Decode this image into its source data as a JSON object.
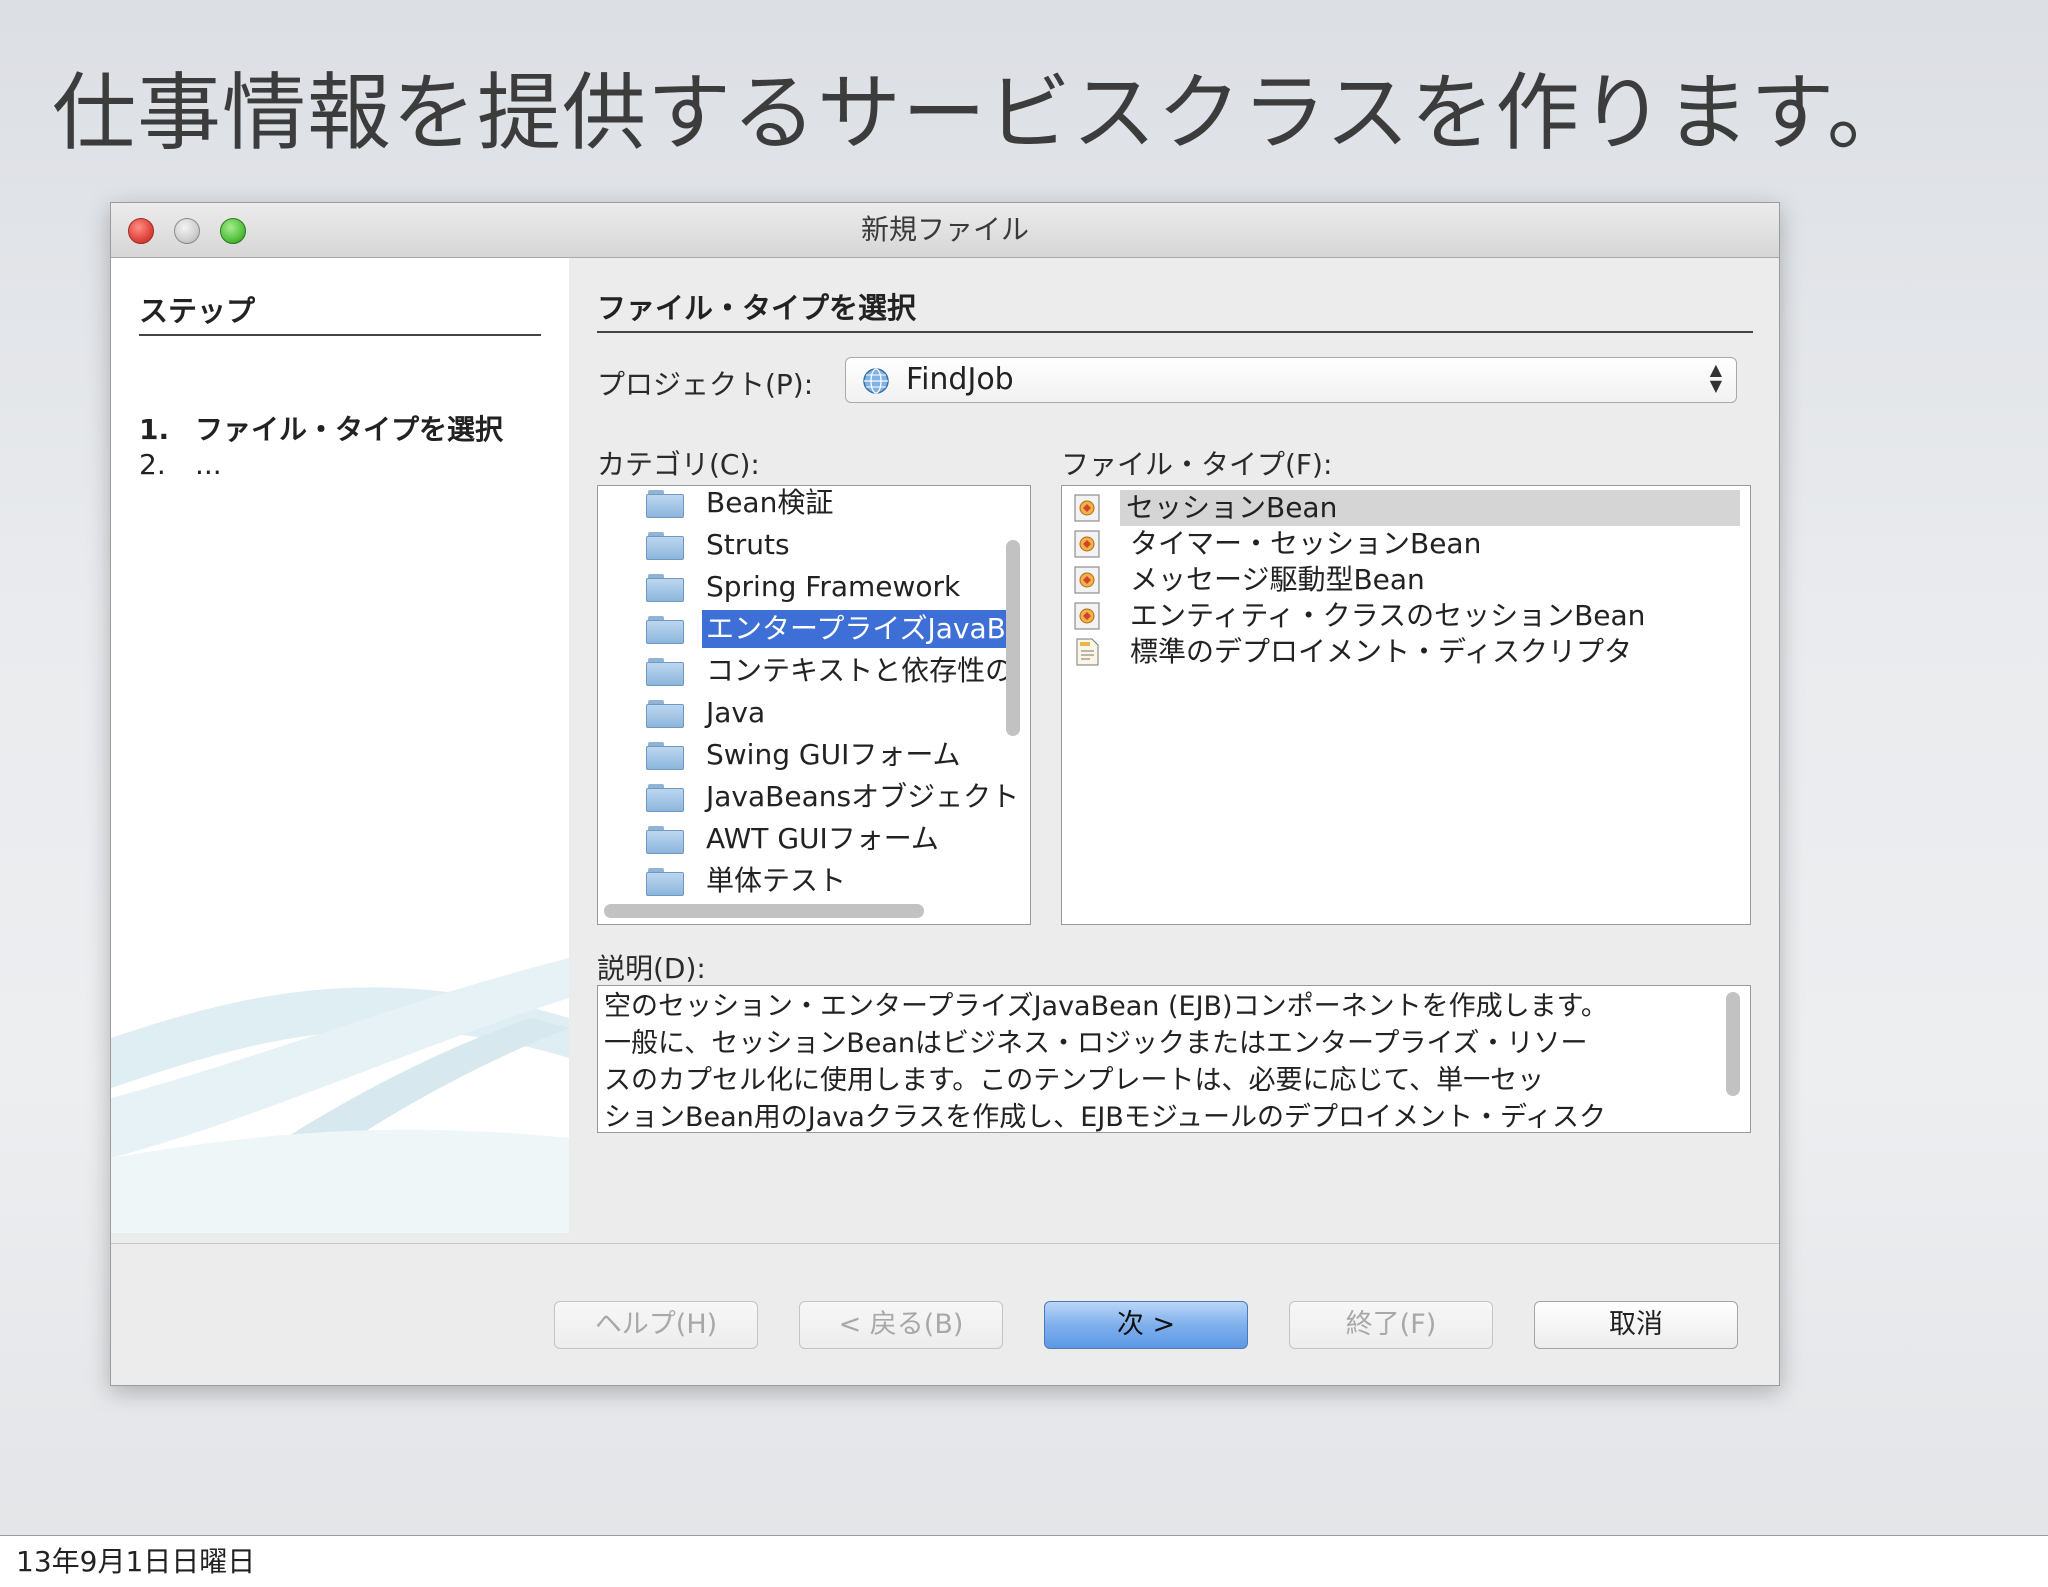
{
  "slide": {
    "title": "仕事情報を提供するサービスクラスを作ります。",
    "footer_date": "13年9月1日日曜日"
  },
  "dialog": {
    "title": "新規ファイル",
    "steps": {
      "heading": "ステップ",
      "items": [
        {
          "num": "1.",
          "label": "ファイル・タイプを選択"
        },
        {
          "num": "2.",
          "label": "..."
        }
      ]
    },
    "main_heading": "ファイル・タイプを選択",
    "project": {
      "label": "プロジェクト(P):",
      "value": "FindJob",
      "icon": "globe-icon"
    },
    "categories": {
      "label": "カテゴリ(C):",
      "items": [
        {
          "label": "Bean検証",
          "icon": "folder-icon"
        },
        {
          "label": "Struts",
          "icon": "folder-icon"
        },
        {
          "label": "Spring Framework",
          "icon": "folder-icon"
        },
        {
          "label": "エンタープライズJavaB",
          "icon": "folder-icon",
          "selected": true
        },
        {
          "label": "コンテキストと依存性の",
          "icon": "folder-icon"
        },
        {
          "label": "Java",
          "icon": "folder-icon"
        },
        {
          "label": "Swing GUIフォーム",
          "icon": "folder-icon"
        },
        {
          "label": "JavaBeansオブジェクト",
          "icon": "folder-icon"
        },
        {
          "label": "AWT GUIフォーム",
          "icon": "folder-icon"
        },
        {
          "label": "単体テスト",
          "icon": "folder-icon"
        }
      ]
    },
    "file_types": {
      "label": "ファイル・タイプ(F):",
      "items": [
        {
          "label": "セッションBean",
          "icon": "bean-icon",
          "selected": true
        },
        {
          "label": "タイマー・セッションBean",
          "icon": "bean-icon"
        },
        {
          "label": "メッセージ駆動型Bean",
          "icon": "bean-icon"
        },
        {
          "label": "エンティティ・クラスのセッションBean",
          "icon": "bean-icon"
        },
        {
          "label": "標準のデプロイメント・ディスクリプタ",
          "icon": "descriptor-icon"
        }
      ]
    },
    "description": {
      "label": "説明(D):",
      "lines": [
        "空のセッション・エンタープライズJavaBean (EJB)コンポーネントを作成します。",
        "一般に、セッションBeanはビジネス・ロジックまたはエンタープライズ・リソー",
        "スのカプセル化に使用します。このテンプレートは、必要に応じて、単一セッ",
        "ションBean用のJavaクラスを作成し、EJBモジュールのデプロイメント・ディスク"
      ]
    },
    "buttons": {
      "help": "ヘルプ(H)",
      "back": "< 戻る(B)",
      "next": "次 >",
      "finish": "終了(F)",
      "cancel": "取消"
    },
    "colors": {
      "selection": "#3d6fd6",
      "primary_button": "#7fb0ec"
    }
  }
}
